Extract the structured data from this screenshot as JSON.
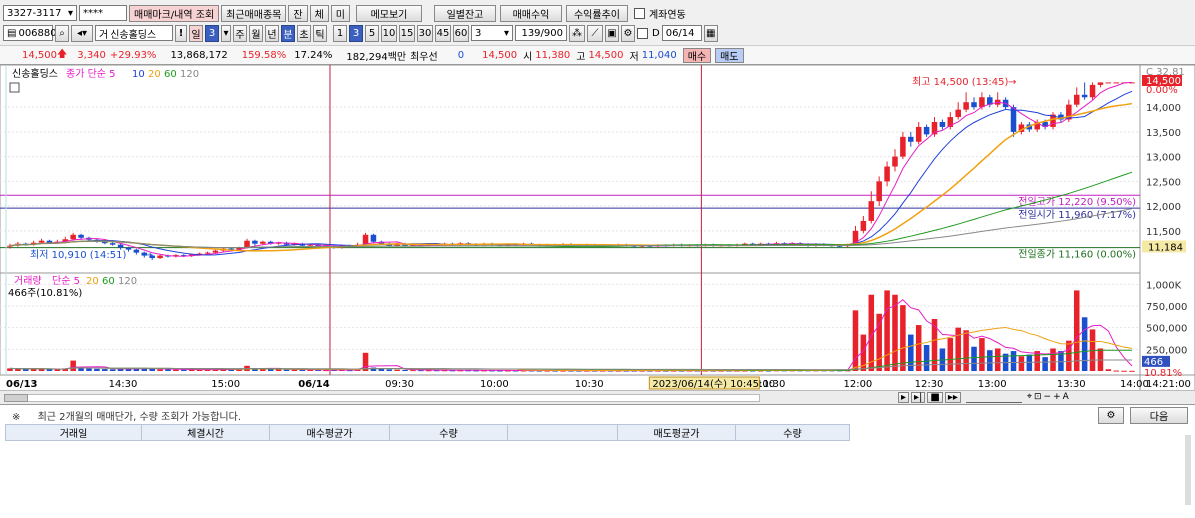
{
  "toolbar1": {
    "account": "3327-3117",
    "password": "****",
    "btn_marks": "매매마크/내역 조회",
    "btn_recent": "최근매매종목",
    "btn_jan": "잔",
    "btn_che": "체",
    "btn_mi": "미",
    "btn_memo": "메모보기",
    "btn_daily": "일별잔고",
    "btn_profit": "매매수익",
    "btn_yield": "수익률추이",
    "link_label": "계좌연동"
  },
  "toolbar2": {
    "code": "006880",
    "stock_name": "신송홀딩스",
    "period_btns": [
      "일",
      "3",
      "주",
      "월",
      "년",
      "분",
      "초",
      "틱"
    ],
    "minute_btns": [
      "1",
      "3",
      "5",
      "10",
      "15",
      "30",
      "45",
      "60"
    ],
    "interval_value": "3",
    "count": "139/900",
    "date_prefix": "D",
    "date": "06/14"
  },
  "quote": {
    "price": "14,500",
    "change": "3,340",
    "change_pct": "+29.93%",
    "volume": "13,868,172",
    "vol_ratio": "159.58%",
    "turnover": "17.24%",
    "amount": "182,294백만",
    "best_label": "최우선",
    "best_qty": "0",
    "best_price": "14,500",
    "open_label": "시",
    "open": "11,380",
    "high_label": "고",
    "high": "14,500",
    "low_label": "저",
    "low": "11,040",
    "buy_btn": "매수",
    "sell_btn": "매도"
  },
  "chart_labels": {
    "price_legend_name": "신송홀딩스",
    "price_legend_ma": "종가 단순 5",
    "price_legend_periods": [
      "10",
      "20",
      "60",
      "120"
    ],
    "vol_legend_name": "거래량",
    "vol_legend_ma": "단순 5",
    "vol_legend_periods": [
      "20",
      "60",
      "120"
    ],
    "vol_info": "466주(10.81%)",
    "high_annot": "최고 14,500 (13:45)",
    "low_annot": "최저 10,910 (14:51)",
    "prev_high": "전일고가 12,220 (9.50%)",
    "prev_open": "전일시가 11,960 (7.17%)",
    "prev_close": "전일종가 11,160 (0.00%)",
    "cursor_date": "2023/06/14(수) 10:45:00",
    "right_top": "C 32.81",
    "right_price_tag": "14,500",
    "right_pct_tag": "0.00%",
    "right_close_tag": "11,184",
    "right_vol_tag": "466",
    "right_vol_pct": "10.81%",
    "right_time": "14:21:00"
  },
  "colors": {
    "up": "#e8222a",
    "down": "#1a4fd0",
    "ma5": "#e81cc6",
    "ma10": "#1f3fd8",
    "ma20": "#f0a010",
    "ma60": "#1e9a1e",
    "ma120": "#888888",
    "prev_high": "#c020c0",
    "prev_open": "#3030a0",
    "prev_close": "#207020"
  },
  "chart_data": {
    "type": "candlestick",
    "x_ticks": [
      "06/13",
      "14:30",
      "15:00",
      "06/14",
      "09:30",
      "10:00",
      "10:30",
      "11:00",
      "11:30",
      "12:00",
      "12:30",
      "13:00",
      "13:30",
      "14:00"
    ],
    "y_ticks": [
      "14,000",
      "13,500",
      "13,000",
      "12,500",
      "12,000",
      "11,500"
    ],
    "vol_ticks": [
      "1,000K",
      "750,000",
      "500,000",
      "250,000"
    ],
    "ylim": [
      10850,
      14650
    ],
    "vol_ylim": [
      0,
      1050000
    ],
    "candles": [
      {
        "o": 11180,
        "c": 11200,
        "h": 11240,
        "l": 11140,
        "v": 30000
      },
      {
        "o": 11200,
        "c": 11240,
        "h": 11280,
        "l": 11180,
        "v": 26000
      },
      {
        "o": 11240,
        "c": 11220,
        "h": 11260,
        "l": 11200,
        "v": 22000
      },
      {
        "o": 11220,
        "c": 11260,
        "h": 11300,
        "l": 11200,
        "v": 24000
      },
      {
        "o": 11260,
        "c": 11300,
        "h": 11340,
        "l": 11240,
        "v": 26000
      },
      {
        "o": 11300,
        "c": 11260,
        "h": 11320,
        "l": 11240,
        "v": 20000
      },
      {
        "o": 11260,
        "c": 11280,
        "h": 11320,
        "l": 11240,
        "v": 18000
      },
      {
        "o": 11280,
        "c": 11330,
        "h": 11380,
        "l": 11260,
        "v": 30000
      },
      {
        "o": 11330,
        "c": 11420,
        "h": 11460,
        "l": 11300,
        "v": 120000
      },
      {
        "o": 11420,
        "c": 11360,
        "h": 11440,
        "l": 11320,
        "v": 40000
      },
      {
        "o": 11360,
        "c": 11320,
        "h": 11380,
        "l": 11300,
        "v": 28000
      },
      {
        "o": 11320,
        "c": 11280,
        "h": 11340,
        "l": 11260,
        "v": 25000
      },
      {
        "o": 11280,
        "c": 11250,
        "h": 11300,
        "l": 11230,
        "v": 22000
      },
      {
        "o": 11250,
        "c": 11220,
        "h": 11270,
        "l": 11200,
        "v": 20000
      },
      {
        "o": 11220,
        "c": 11160,
        "h": 11240,
        "l": 11120,
        "v": 30000
      },
      {
        "o": 11160,
        "c": 11120,
        "h": 11180,
        "l": 11080,
        "v": 28000
      },
      {
        "o": 11120,
        "c": 11060,
        "h": 11140,
        "l": 11020,
        "v": 26000
      },
      {
        "o": 11060,
        "c": 11000,
        "h": 11080,
        "l": 10960,
        "v": 30000
      },
      {
        "o": 11000,
        "c": 10950,
        "h": 11020,
        "l": 10910,
        "v": 24000
      },
      {
        "o": 10950,
        "c": 11000,
        "h": 11020,
        "l": 10930,
        "v": 20000
      },
      {
        "o": 11000,
        "c": 10980,
        "h": 11020,
        "l": 10960,
        "v": 18000
      },
      {
        "o": 10980,
        "c": 11010,
        "h": 11030,
        "l": 10960,
        "v": 16000
      },
      {
        "o": 11010,
        "c": 10990,
        "h": 11030,
        "l": 10970,
        "v": 15000
      },
      {
        "o": 10990,
        "c": 11020,
        "h": 11040,
        "l": 10970,
        "v": 15000
      },
      {
        "o": 11020,
        "c": 11040,
        "h": 11060,
        "l": 11000,
        "v": 16000
      },
      {
        "o": 11040,
        "c": 11060,
        "h": 11080,
        "l": 11020,
        "v": 15000
      },
      {
        "o": 11060,
        "c": 11100,
        "h": 11120,
        "l": 11040,
        "v": 18000
      },
      {
        "o": 11100,
        "c": 11140,
        "h": 11160,
        "l": 11080,
        "v": 20000
      },
      {
        "o": 11140,
        "c": 11120,
        "h": 11160,
        "l": 11100,
        "v": 14000
      },
      {
        "o": 11120,
        "c": 11160,
        "h": 11180,
        "l": 11100,
        "v": 16000
      },
      {
        "o": 11160,
        "c": 11300,
        "h": 11340,
        "l": 11140,
        "v": 60000
      },
      {
        "o": 11300,
        "c": 11240,
        "h": 11320,
        "l": 11200,
        "v": 30000
      },
      {
        "o": 11240,
        "c": 11280,
        "h": 11300,
        "l": 11220,
        "v": 22000
      },
      {
        "o": 11280,
        "c": 11240,
        "h": 11300,
        "l": 11220,
        "v": 20000
      },
      {
        "o": 11240,
        "c": 11260,
        "h": 11280,
        "l": 11220,
        "v": 18000
      },
      {
        "o": 11260,
        "c": 11220,
        "h": 11280,
        "l": 11200,
        "v": 16000
      },
      {
        "o": 11220,
        "c": 11240,
        "h": 11260,
        "l": 11200,
        "v": 14000
      },
      {
        "o": 11240,
        "c": 11200,
        "h": 11260,
        "l": 11180,
        "v": 15000
      },
      {
        "o": 11200,
        "c": 11220,
        "h": 11240,
        "l": 11180,
        "v": 12000
      },
      {
        "o": 11220,
        "c": 11180,
        "h": 11240,
        "l": 11160,
        "v": 12000
      },
      {
        "o": 11180,
        "c": 11200,
        "h": 11220,
        "l": 11160,
        "v": 10000
      },
      {
        "o": 11200,
        "c": 11160,
        "h": 11220,
        "l": 11140,
        "v": 12000
      },
      {
        "o": 11160,
        "c": 11200,
        "h": 11220,
        "l": 11140,
        "v": 12000
      },
      {
        "o": 11200,
        "c": 11180,
        "h": 11220,
        "l": 11160,
        "v": 10000
      },
      {
        "o": 11180,
        "c": 11220,
        "h": 11260,
        "l": 11160,
        "v": 14000
      },
      {
        "o": 11220,
        "c": 11420,
        "h": 11460,
        "l": 11200,
        "v": 210000
      },
      {
        "o": 11420,
        "c": 11280,
        "h": 11440,
        "l": 11260,
        "v": 40000
      },
      {
        "o": 11280,
        "c": 11240,
        "h": 11300,
        "l": 11220,
        "v": 24000
      },
      {
        "o": 11240,
        "c": 11200,
        "h": 11260,
        "l": 11180,
        "v": 18000
      },
      {
        "o": 11200,
        "c": 11240,
        "h": 11260,
        "l": 11180,
        "v": 15000
      },
      {
        "o": 11240,
        "c": 11200,
        "h": 11260,
        "l": 11180,
        "v": 12000
      },
      {
        "o": 11200,
        "c": 11220,
        "h": 11240,
        "l": 11180,
        "v": 10000
      },
      {
        "o": 11220,
        "c": 11200,
        "h": 11240,
        "l": 11180,
        "v": 10000
      },
      {
        "o": 11200,
        "c": 11230,
        "h": 11250,
        "l": 11180,
        "v": 9000
      },
      {
        "o": 11230,
        "c": 11210,
        "h": 11250,
        "l": 11190,
        "v": 9000
      },
      {
        "o": 11210,
        "c": 11240,
        "h": 11260,
        "l": 11190,
        "v": 9000
      },
      {
        "o": 11240,
        "c": 11220,
        "h": 11260,
        "l": 11200,
        "v": 8000
      },
      {
        "o": 11220,
        "c": 11250,
        "h": 11270,
        "l": 11200,
        "v": 8000
      },
      {
        "o": 11250,
        "c": 11230,
        "h": 11270,
        "l": 11210,
        "v": 8000
      },
      {
        "o": 11230,
        "c": 11210,
        "h": 11250,
        "l": 11190,
        "v": 7000
      },
      {
        "o": 11210,
        "c": 11240,
        "h": 11260,
        "l": 11190,
        "v": 7000
      },
      {
        "o": 11240,
        "c": 11220,
        "h": 11260,
        "l": 11200,
        "v": 7000
      },
      {
        "o": 11220,
        "c": 11200,
        "h": 11240,
        "l": 11180,
        "v": 6000
      },
      {
        "o": 11200,
        "c": 11230,
        "h": 11250,
        "l": 11180,
        "v": 6000
      },
      {
        "o": 11230,
        "c": 11210,
        "h": 11250,
        "l": 11190,
        "v": 6000
      },
      {
        "o": 11210,
        "c": 11240,
        "h": 11260,
        "l": 11190,
        "v": 6000
      },
      {
        "o": 11240,
        "c": 11220,
        "h": 11260,
        "l": 11200,
        "v": 6000
      },
      {
        "o": 11220,
        "c": 11200,
        "h": 11240,
        "l": 11180,
        "v": 5000
      },
      {
        "o": 11200,
        "c": 11220,
        "h": 11240,
        "l": 11180,
        "v": 5000
      },
      {
        "o": 11220,
        "c": 11210,
        "h": 11240,
        "l": 11190,
        "v": 5000
      },
      {
        "o": 11210,
        "c": 11230,
        "h": 11250,
        "l": 11190,
        "v": 5000
      },
      {
        "o": 11230,
        "c": 11210,
        "h": 11250,
        "l": 11190,
        "v": 5000
      },
      {
        "o": 11210,
        "c": 11200,
        "h": 11230,
        "l": 11180,
        "v": 5000
      },
      {
        "o": 11200,
        "c": 11220,
        "h": 11240,
        "l": 11180,
        "v": 5000
      },
      {
        "o": 11220,
        "c": 11200,
        "h": 11240,
        "l": 11180,
        "v": 5000
      },
      {
        "o": 11200,
        "c": 11210,
        "h": 11230,
        "l": 11180,
        "v": 5000
      },
      {
        "o": 11210,
        "c": 11200,
        "h": 11230,
        "l": 11180,
        "v": 5000
      },
      {
        "o": 11200,
        "c": 11220,
        "h": 11240,
        "l": 11180,
        "v": 5000
      },
      {
        "o": 11220,
        "c": 11200,
        "h": 11240,
        "l": 11180,
        "v": 5000
      },
      {
        "o": 11200,
        "c": 11180,
        "h": 11220,
        "l": 11160,
        "v": 5000
      },
      {
        "o": 11180,
        "c": 11200,
        "h": 11220,
        "l": 11160,
        "v": 5000
      },
      {
        "o": 11200,
        "c": 11190,
        "h": 11220,
        "l": 11170,
        "v": 5000
      },
      {
        "o": 11190,
        "c": 11210,
        "h": 11230,
        "l": 11170,
        "v": 5000
      },
      {
        "o": 11210,
        "c": 11200,
        "h": 11230,
        "l": 11180,
        "v": 5000
      },
      {
        "o": 11200,
        "c": 11220,
        "h": 11240,
        "l": 11180,
        "v": 5000
      },
      {
        "o": 11220,
        "c": 11200,
        "h": 11240,
        "l": 11180,
        "v": 5000
      },
      {
        "o": 11200,
        "c": 11210,
        "h": 11230,
        "l": 11180,
        "v": 5000
      },
      {
        "o": 11210,
        "c": 11200,
        "h": 11230,
        "l": 11180,
        "v": 5000
      },
      {
        "o": 11200,
        "c": 11220,
        "h": 11240,
        "l": 11180,
        "v": 5000
      },
      {
        "o": 11220,
        "c": 11200,
        "h": 11240,
        "l": 11180,
        "v": 5000
      },
      {
        "o": 11200,
        "c": 11210,
        "h": 11230,
        "l": 11180,
        "v": 5000
      },
      {
        "o": 11210,
        "c": 11200,
        "h": 11230,
        "l": 11180,
        "v": 5000
      },
      {
        "o": 11200,
        "c": 11220,
        "h": 11240,
        "l": 11180,
        "v": 5000
      },
      {
        "o": 11220,
        "c": 11240,
        "h": 11260,
        "l": 11200,
        "v": 6000
      },
      {
        "o": 11240,
        "c": 11220,
        "h": 11260,
        "l": 11200,
        "v": 6000
      },
      {
        "o": 11220,
        "c": 11240,
        "h": 11260,
        "l": 11200,
        "v": 6000
      },
      {
        "o": 11240,
        "c": 11220,
        "h": 11260,
        "l": 11200,
        "v": 6000
      },
      {
        "o": 11220,
        "c": 11250,
        "h": 11280,
        "l": 11200,
        "v": 8000
      },
      {
        "o": 11250,
        "c": 11230,
        "h": 11270,
        "l": 11210,
        "v": 8000
      },
      {
        "o": 11230,
        "c": 11250,
        "h": 11270,
        "l": 11210,
        "v": 8000
      },
      {
        "o": 11250,
        "c": 11230,
        "h": 11270,
        "l": 11210,
        "v": 8000
      },
      {
        "o": 11230,
        "c": 11200,
        "h": 11250,
        "l": 11180,
        "v": 8000
      },
      {
        "o": 11200,
        "c": 11230,
        "h": 11250,
        "l": 11180,
        "v": 8000
      },
      {
        "o": 11230,
        "c": 11210,
        "h": 11250,
        "l": 11190,
        "v": 8000
      },
      {
        "o": 11210,
        "c": 11200,
        "h": 11230,
        "l": 11180,
        "v": 8000
      },
      {
        "o": 11200,
        "c": 11190,
        "h": 11220,
        "l": 11170,
        "v": 8000
      },
      {
        "o": 11190,
        "c": 11220,
        "h": 11240,
        "l": 11170,
        "v": 8000
      },
      {
        "o": 11220,
        "c": 11500,
        "h": 11600,
        "l": 11200,
        "v": 700000
      },
      {
        "o": 11500,
        "c": 11700,
        "h": 11800,
        "l": 11450,
        "v": 420000
      },
      {
        "o": 11700,
        "c": 12100,
        "h": 12300,
        "l": 11650,
        "v": 880000
      },
      {
        "o": 12100,
        "c": 12500,
        "h": 12600,
        "l": 12000,
        "v": 660000
      },
      {
        "o": 12500,
        "c": 12800,
        "h": 12900,
        "l": 12400,
        "v": 930000
      },
      {
        "o": 12800,
        "c": 13000,
        "h": 13150,
        "l": 12700,
        "v": 880000
      },
      {
        "o": 13000,
        "c": 13400,
        "h": 13500,
        "l": 12950,
        "v": 760000
      },
      {
        "o": 13400,
        "c": 13300,
        "h": 13500,
        "l": 13200,
        "v": 420000
      },
      {
        "o": 13300,
        "c": 13600,
        "h": 13700,
        "l": 13250,
        "v": 530000
      },
      {
        "o": 13600,
        "c": 13450,
        "h": 13650,
        "l": 13400,
        "v": 300000
      },
      {
        "o": 13450,
        "c": 13700,
        "h": 13800,
        "l": 13400,
        "v": 600000
      },
      {
        "o": 13700,
        "c": 13600,
        "h": 13750,
        "l": 13550,
        "v": 260000
      },
      {
        "o": 13600,
        "c": 13800,
        "h": 13900,
        "l": 13550,
        "v": 380000
      },
      {
        "o": 13800,
        "c": 13950,
        "h": 14100,
        "l": 13750,
        "v": 500000
      },
      {
        "o": 13950,
        "c": 14100,
        "h": 14300,
        "l": 13900,
        "v": 470000
      },
      {
        "o": 14100,
        "c": 14000,
        "h": 14200,
        "l": 13950,
        "v": 280000
      },
      {
        "o": 14000,
        "c": 14200,
        "h": 14300,
        "l": 13950,
        "v": 380000
      },
      {
        "o": 14200,
        "c": 14050,
        "h": 14250,
        "l": 14000,
        "v": 240000
      },
      {
        "o": 14050,
        "c": 14150,
        "h": 14300,
        "l": 14000,
        "v": 260000
      },
      {
        "o": 14150,
        "c": 14000,
        "h": 14200,
        "l": 13950,
        "v": 200000
      },
      {
        "o": 14000,
        "c": 13500,
        "h": 14050,
        "l": 13400,
        "v": 230000
      },
      {
        "o": 13500,
        "c": 13650,
        "h": 13700,
        "l": 13450,
        "v": 170000
      },
      {
        "o": 13650,
        "c": 13550,
        "h": 13700,
        "l": 13500,
        "v": 190000
      },
      {
        "o": 13550,
        "c": 13700,
        "h": 13750,
        "l": 13500,
        "v": 230000
      },
      {
        "o": 13700,
        "c": 13600,
        "h": 13750,
        "l": 13550,
        "v": 160000
      },
      {
        "o": 13600,
        "c": 13850,
        "h": 13900,
        "l": 13550,
        "v": 260000
      },
      {
        "o": 13850,
        "c": 13750,
        "h": 13900,
        "l": 13700,
        "v": 230000
      },
      {
        "o": 13750,
        "c": 14050,
        "h": 14150,
        "l": 13700,
        "v": 350000
      },
      {
        "o": 14050,
        "c": 14250,
        "h": 14400,
        "l": 14000,
        "v": 930000
      },
      {
        "o": 14250,
        "c": 14200,
        "h": 14500,
        "l": 14150,
        "v": 620000
      },
      {
        "o": 14200,
        "c": 14450,
        "h": 14500,
        "l": 14150,
        "v": 480000
      },
      {
        "o": 14450,
        "c": 14500,
        "h": 14500,
        "l": 14400,
        "v": 260000
      },
      {
        "o": 14500,
        "c": 14500,
        "h": 14500,
        "l": 14500,
        "v": 20000
      },
      {
        "o": 14500,
        "c": 14500,
        "h": 14500,
        "l": 14500,
        "v": 5000
      },
      {
        "o": 14500,
        "c": 14500,
        "h": 14500,
        "l": 14500,
        "v": 3000
      },
      {
        "o": 14500,
        "c": 14500,
        "h": 14500,
        "l": 14500,
        "v": 2000
      }
    ]
  },
  "bottom": {
    "notice_mark": "※",
    "notice": "최근 2개월의 매매단가, 수량 조회가 가능합니다.",
    "next_btn": "다음",
    "columns": [
      "거래일",
      "체결시간",
      "매수평균가",
      "수량",
      "",
      "매도평균가",
      "수량"
    ]
  }
}
